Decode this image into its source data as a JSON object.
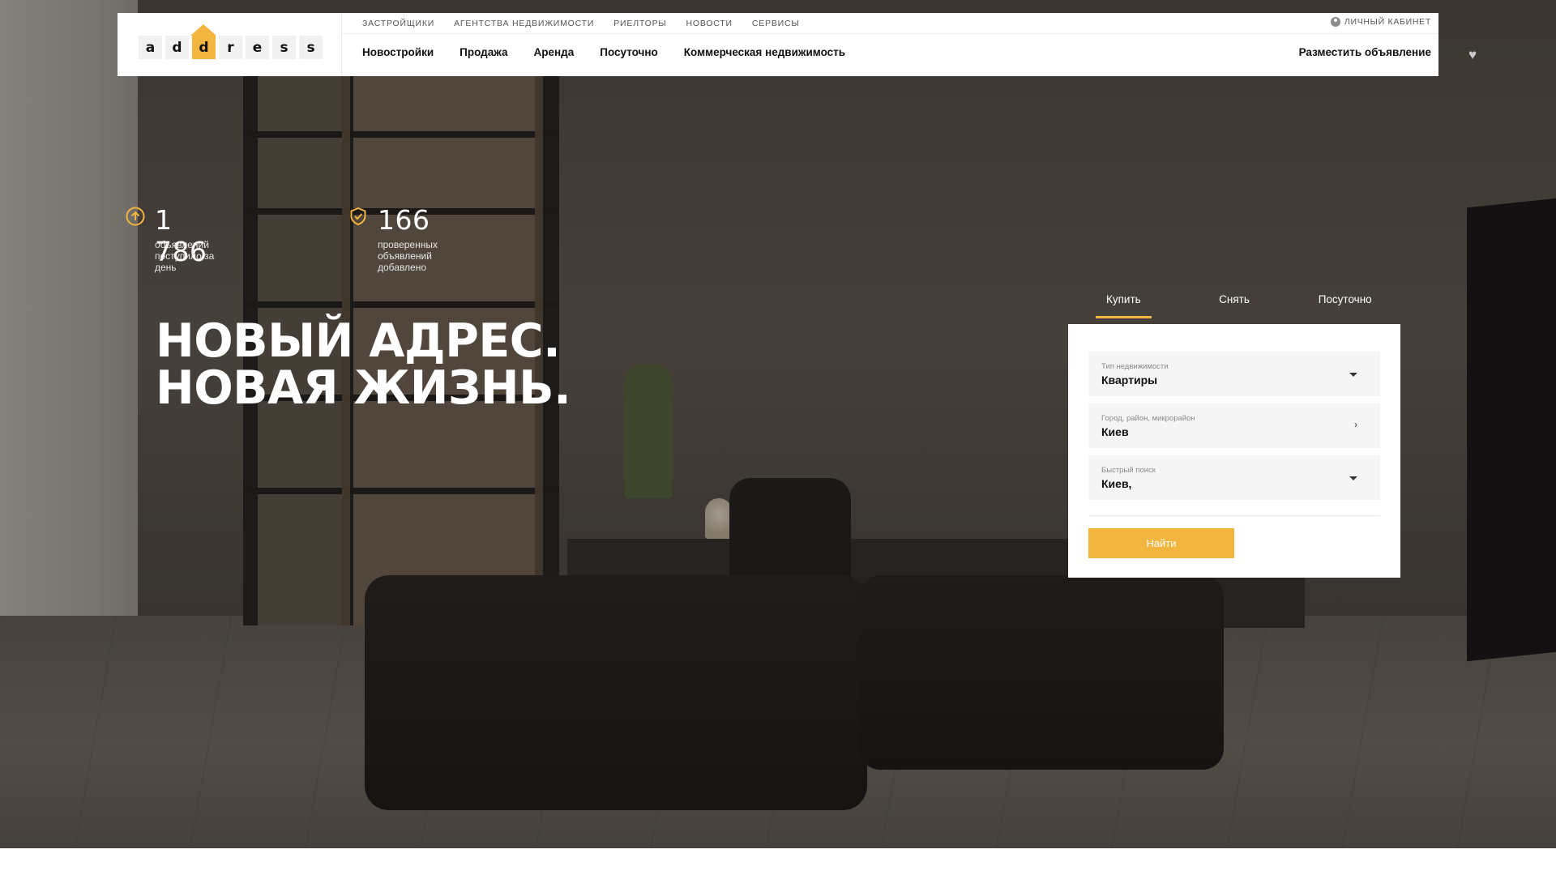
{
  "logo": {
    "letters": [
      "a",
      "d",
      "d",
      "r",
      "e",
      "s",
      "s"
    ]
  },
  "topnav": {
    "items": [
      "ЗАСТРОЙЩИКИ",
      "АГЕНТСТВА НЕДВИЖИМОСТИ",
      "РИЕЛТОРЫ",
      "НОВОСТИ",
      "СЕРВИСЫ"
    ],
    "cabinet": "ЛИЧНЫЙ КАБИНЕТ"
  },
  "mainnav": {
    "items": [
      "Новостройки",
      "Продажа",
      "Аренда",
      "Посуточно",
      "Коммерческая недвижимость"
    ],
    "post_ad": "Разместить объявление"
  },
  "stats": [
    {
      "number": "1 786",
      "desc": "объявлений поступило за день",
      "icon": "arrow-up-circle-icon"
    },
    {
      "number": "166",
      "desc": "проверенных объявлений добавлено",
      "icon": "shield-check-icon"
    }
  ],
  "headline": {
    "line1": "НОВЫЙ АДРЕС.",
    "line2": "НОВАЯ ЖИЗНЬ."
  },
  "search": {
    "tabs": [
      "Купить",
      "Снять",
      "Посуточно"
    ],
    "active_tab": "Купить",
    "fields": [
      {
        "label": "Тип недвижимости",
        "value": "Квартиры"
      },
      {
        "label": "Город, район, микрорайон",
        "value": "Киев"
      },
      {
        "label": "Быстрый поиск",
        "value": "Киев,"
      }
    ],
    "button": "Найти"
  },
  "colors": {
    "accent": "#f2b53f",
    "header_bg": "#ffffff",
    "text_dark": "#111111"
  }
}
